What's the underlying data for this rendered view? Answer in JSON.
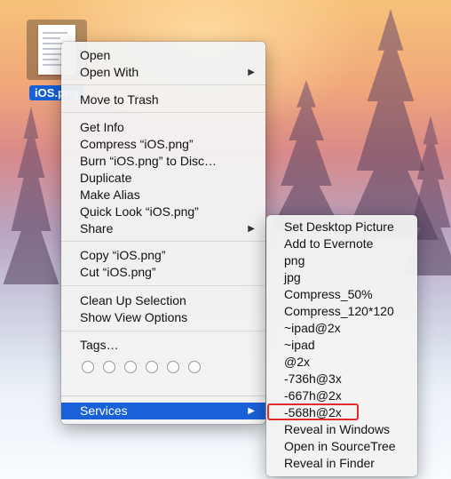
{
  "desktop": {
    "icon_label": "iOS.png"
  },
  "context_menu": {
    "items": [
      {
        "label": "Open"
      },
      {
        "label": "Open With"
      },
      {
        "label": "Move to Trash"
      },
      {
        "label": "Get Info"
      },
      {
        "label": "Compress “iOS.png”"
      },
      {
        "label": "Burn “iOS.png” to Disc…"
      },
      {
        "label": "Duplicate"
      },
      {
        "label": "Make Alias"
      },
      {
        "label": "Quick Look “iOS.png”"
      },
      {
        "label": "Share"
      },
      {
        "label": "Copy “iOS.png”"
      },
      {
        "label": "Cut “iOS.png”"
      },
      {
        "label": "Clean Up Selection"
      },
      {
        "label": "Show View Options"
      },
      {
        "label": "Tags…"
      },
      {
        "label": "Services"
      }
    ],
    "submenu_arrow": "▶"
  },
  "services_submenu": {
    "items": [
      {
        "label": "Set Desktop Picture"
      },
      {
        "label": "Add to Evernote"
      },
      {
        "label": "png"
      },
      {
        "label": "jpg"
      },
      {
        "label": "Compress_50%"
      },
      {
        "label": "Compress_120*120"
      },
      {
        "label": "~ipad@2x"
      },
      {
        "label": "~ipad"
      },
      {
        "label": "@2x"
      },
      {
        "label": "-736h@3x"
      },
      {
        "label": "-667h@2x"
      },
      {
        "label": "-568h@2x"
      },
      {
        "label": "Reveal in Windows"
      },
      {
        "label": "Open in SourceTree"
      },
      {
        "label": "Reveal in Finder"
      }
    ]
  },
  "colors": {
    "highlight": "#1a60d8",
    "focus_outline": "#e32b2b"
  }
}
